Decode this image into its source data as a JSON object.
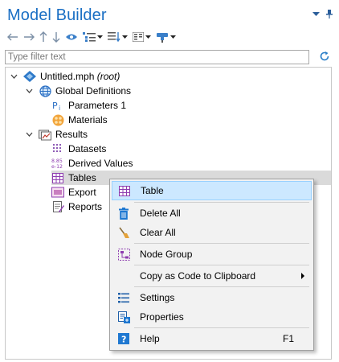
{
  "window": {
    "title": "Model Builder"
  },
  "filter": {
    "placeholder": "Type filter text"
  },
  "tree": {
    "root": {
      "label": "Untitled.mph",
      "suffix": "(root)"
    },
    "global_definitions": {
      "label": "Global Definitions"
    },
    "parameters": {
      "label": "Parameters 1"
    },
    "materials": {
      "label": "Materials"
    },
    "results": {
      "label": "Results"
    },
    "datasets": {
      "label": "Datasets"
    },
    "derived_values": {
      "label": "Derived Values"
    },
    "tables": {
      "label": "Tables"
    },
    "export": {
      "label": "Export"
    },
    "reports": {
      "label": "Reports"
    }
  },
  "context_menu": {
    "table": "Table",
    "delete_all": "Delete All",
    "clear_all": "Clear All",
    "node_group": "Node Group",
    "copy_code": "Copy as Code to Clipboard",
    "settings": "Settings",
    "properties": "Properties",
    "help": "Help",
    "help_shortcut": "F1"
  },
  "derived_icon_text": {
    "top": "8.85",
    "bottom": "e-12"
  },
  "colors": {
    "title": "#1a6fc4",
    "selection": "#dadada",
    "menu_highlight": "#cce8ff",
    "accent_blue": "#1f78d1"
  }
}
